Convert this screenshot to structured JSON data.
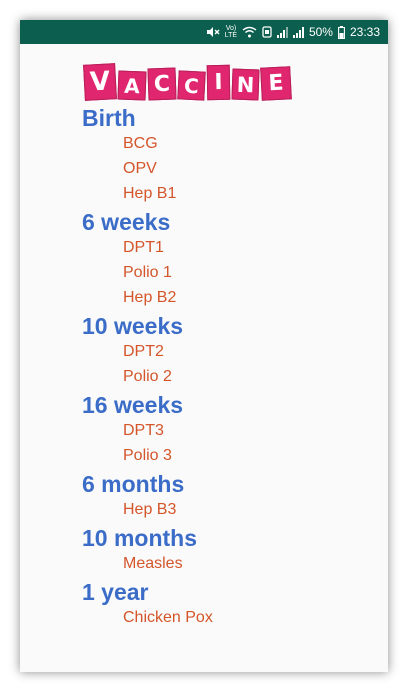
{
  "status_bar": {
    "battery": "50%",
    "time": "23:33",
    "network_label": "Vo) LTE",
    "icons": [
      "mute-icon",
      "volte-icon",
      "wifi-icon",
      "data-icon",
      "signal-icon",
      "signal-icon",
      "battery-icon"
    ],
    "background_color": "#0c5e4e"
  },
  "logo": {
    "letters": [
      "V",
      "A",
      "C",
      "C",
      "I",
      "N",
      "E"
    ],
    "color": "#e0266e"
  },
  "colors": {
    "section_title": "#3a6cc8",
    "vaccine_item": "#d4552a"
  },
  "schedule": [
    {
      "age": "Birth",
      "vaccines": [
        "BCG",
        "OPV",
        "Hep B1"
      ]
    },
    {
      "age": "6 weeks",
      "vaccines": [
        "DPT1",
        "Polio 1",
        "Hep B2"
      ]
    },
    {
      "age": "10 weeks",
      "vaccines": [
        "DPT2",
        "Polio 2"
      ]
    },
    {
      "age": "16 weeks",
      "vaccines": [
        "DPT3",
        "Polio 3"
      ]
    },
    {
      "age": "6 months",
      "vaccines": [
        "Hep B3"
      ]
    },
    {
      "age": "10 months",
      "vaccines": [
        "Measles"
      ]
    },
    {
      "age": "1 year",
      "vaccines": [
        "Chicken Pox"
      ]
    }
  ]
}
